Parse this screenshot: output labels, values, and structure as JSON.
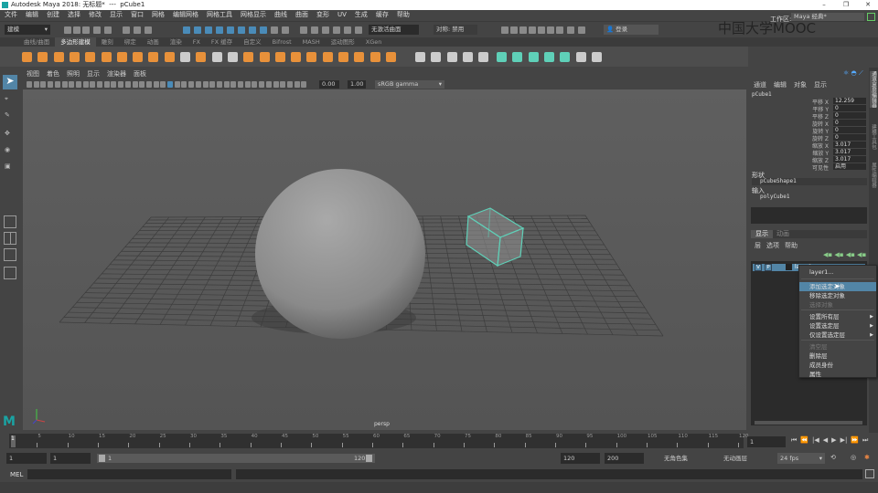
{
  "title": {
    "app": "Autodesk Maya 2018: 无标题*",
    "sep": "---",
    "object": "pCube1",
    "min": "–",
    "max": "❐",
    "close": "✕"
  },
  "menu": [
    "文件",
    "编辑",
    "创建",
    "选择",
    "修改",
    "显示",
    "窗口",
    "网格",
    "编辑网格",
    "网格工具",
    "网格显示",
    "曲线",
    "曲面",
    "变形",
    "UV",
    "生成",
    "缓存",
    "帮助"
  ],
  "status": {
    "mode": "建模",
    "live_surface": "无激活曲面",
    "symmetry": "对称: 禁用",
    "login": "登录",
    "workspace_label": "工作区:",
    "workspace": "Maya 经典*"
  },
  "watermark": "中国大学MOOC",
  "shelf_tabs": [
    "曲线/曲面",
    "多边形建模",
    "雕刻",
    "绑定",
    "动画",
    "渲染",
    "FX",
    "FX 缓存",
    "自定义",
    "Bifrost",
    "MASH",
    "运动图形",
    "XGen"
  ],
  "shelf_active": 1,
  "viewport": {
    "menu": [
      "视图",
      "着色",
      "照明",
      "显示",
      "渲染器",
      "面板"
    ],
    "exposure": "0.00",
    "gamma": "1.00",
    "colorspace": "sRGB gamma",
    "camera": "persp"
  },
  "channel_box": {
    "menu": [
      "通道",
      "编辑",
      "对象",
      "显示"
    ],
    "object": "pCube1",
    "attrs": [
      {
        "label": "平移 X",
        "value": "12.259"
      },
      {
        "label": "平移 Y",
        "value": "0"
      },
      {
        "label": "平移 Z",
        "value": "0"
      },
      {
        "label": "旋转 X",
        "value": "0"
      },
      {
        "label": "旋转 Y",
        "value": "0"
      },
      {
        "label": "旋转 Z",
        "value": "0"
      },
      {
        "label": "缩放 X",
        "value": "3.017"
      },
      {
        "label": "缩放 Y",
        "value": "3.017"
      },
      {
        "label": "缩放 Z",
        "value": "3.017"
      },
      {
        "label": "可见性",
        "value": "启用"
      }
    ],
    "shapes_label": "形状",
    "shape": "pCubeShape1",
    "inputs_label": "输入",
    "input": "polyCube1"
  },
  "layers": {
    "tabs": [
      "显示",
      "动画"
    ],
    "menu": [
      "层",
      "选项",
      "帮助"
    ],
    "v": "V",
    "p": "P",
    "layer": "layer1"
  },
  "context_menu": {
    "title": "layer1...",
    "items": [
      {
        "label": "添加选定对象",
        "state": "hover"
      },
      {
        "label": "移除选定对象",
        "state": "normal"
      },
      {
        "label": "选择对象",
        "state": "disabled"
      },
      {
        "label": "设置所有层",
        "state": "sub"
      },
      {
        "label": "设置选定层",
        "state": "sub"
      },
      {
        "label": "仅设置选定层",
        "state": "sub"
      },
      {
        "label": "清空层",
        "state": "disabled"
      },
      {
        "label": "删除层",
        "state": "normal"
      },
      {
        "label": "成员身份",
        "state": "normal"
      },
      {
        "label": "属性",
        "state": "normal"
      }
    ]
  },
  "vtabs": [
    "通道盒/层编辑器",
    "建模工具包",
    "属性编辑器"
  ],
  "timeline": {
    "ticks": [
      "5",
      "10",
      "15",
      "20",
      "25",
      "30",
      "35",
      "40",
      "45",
      "50",
      "55",
      "60",
      "65",
      "70",
      "75",
      "80",
      "85",
      "90",
      "95",
      "100",
      "105",
      "110",
      "115",
      "120"
    ],
    "current": "1",
    "current_field": "1"
  },
  "range": {
    "start": "1",
    "anim_start": "1",
    "slider_start": "1",
    "slider_end": "120",
    "end": "120",
    "anim_end": "200",
    "char_set": "无角色集",
    "anim_layer": "无动画层",
    "fps": "24 fps"
  },
  "mel": {
    "label": "MEL"
  },
  "colors": {
    "accent": "#5285a6",
    "cube": "#5fd0b8",
    "bg": "#444444"
  }
}
